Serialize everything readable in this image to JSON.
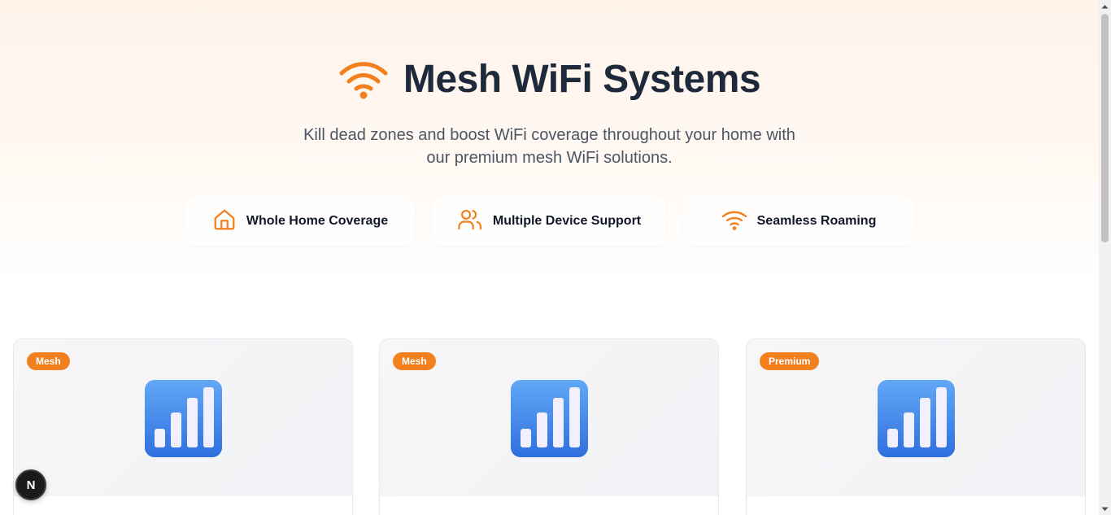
{
  "header": {
    "title": "Mesh WiFi Systems",
    "title_icon": "wifi-icon",
    "subtitle_line1": "Kill dead zones and boost WiFi coverage throughout your home with",
    "subtitle_line2": "our premium mesh WiFi solutions."
  },
  "features": [
    {
      "label": "Whole Home Coverage",
      "icon": "home-icon"
    },
    {
      "label": "Multiple Device Support",
      "icon": "users-icon"
    },
    {
      "label": "Seamless Roaming",
      "icon": "wifi-icon"
    }
  ],
  "products": [
    {
      "badge": "Mesh",
      "icon": "signal-bars-icon"
    },
    {
      "badge": "Mesh",
      "icon": "signal-bars-icon"
    },
    {
      "badge": "Premium",
      "icon": "signal-bars-icon"
    }
  ],
  "dev_badge": {
    "letter": "N"
  },
  "colors": {
    "accent": "#f2801f",
    "title": "#1e293b",
    "subtitle": "#4b5563",
    "icon_blue": "#3b82f6"
  }
}
